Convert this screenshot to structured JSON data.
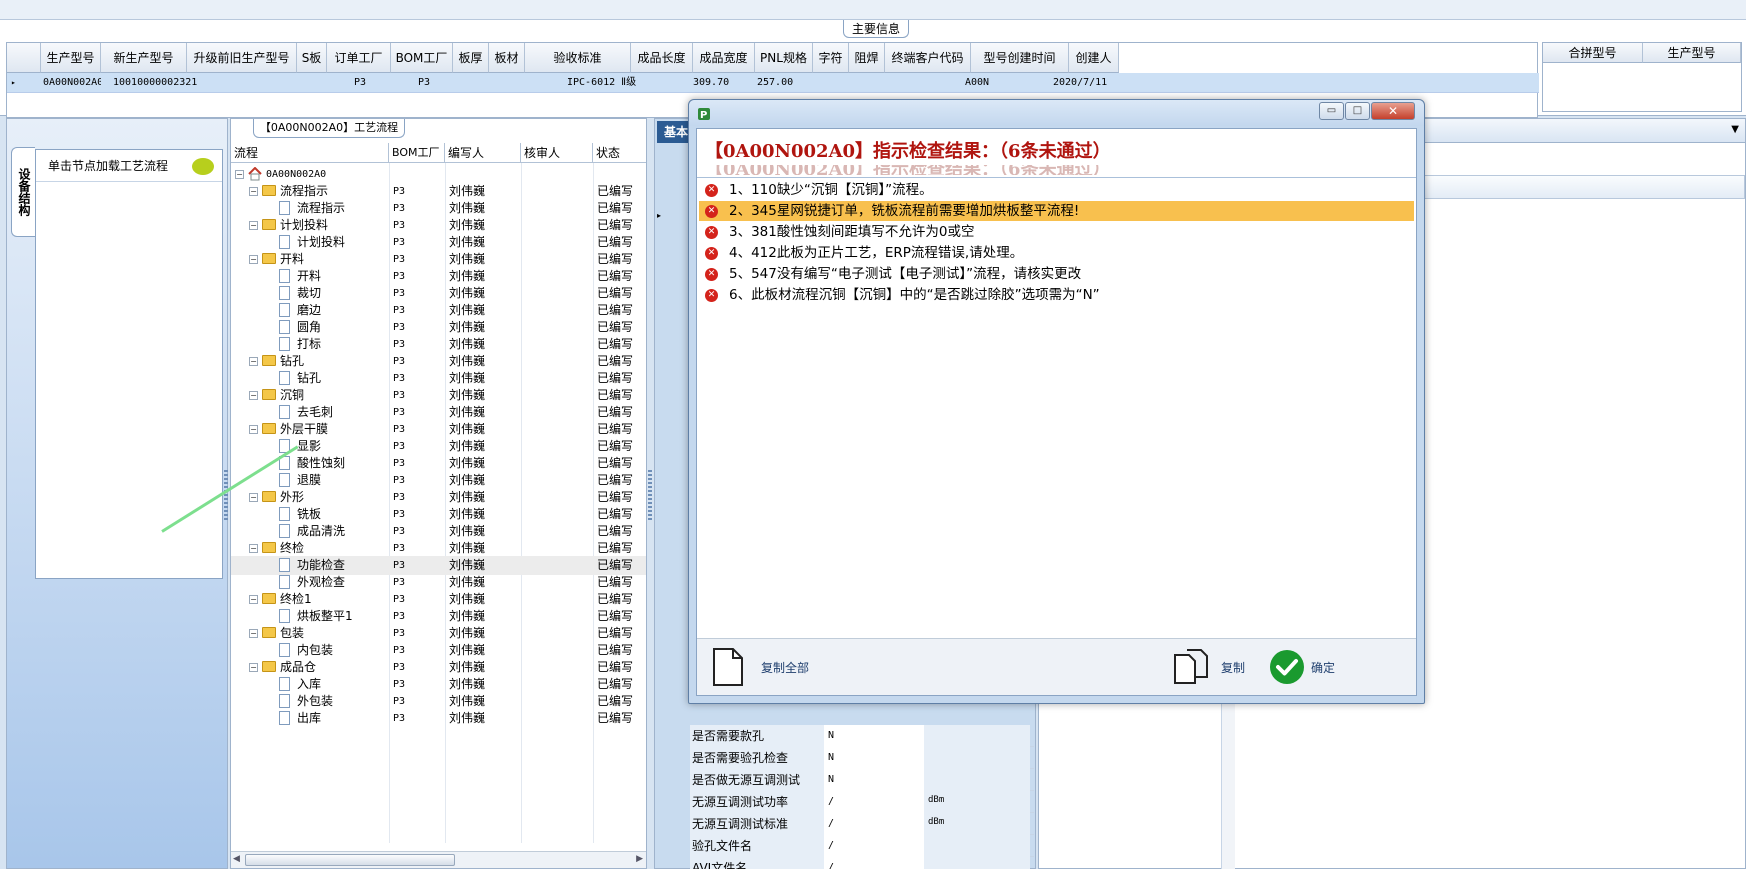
{
  "main_info": {
    "tab_label": "主要信息",
    "columns": [
      "生产型号",
      "新生产型号",
      "升级前旧生产型号",
      "S板",
      "订单工厂",
      "BOM工厂",
      "板厚",
      "板材",
      "验收标准",
      "成品长度",
      "成品宽度",
      "PNL规格",
      "字符",
      "阻焊",
      "终端客户代码",
      "型号创建时间",
      "创建人"
    ],
    "row": [
      "0A00N002A0",
      "10010000002321",
      "",
      "",
      "P3",
      "P3",
      "",
      "",
      "IPC-6012 Ⅱ级",
      "309.70",
      "257.00",
      "",
      "",
      "",
      "A00N",
      "2020/7/11",
      ""
    ],
    "merge_columns": [
      "合拼型号",
      "生产型号"
    ]
  },
  "left_panel": {
    "vertical_tab": "设备结构",
    "hint": "单击节点加载工艺流程"
  },
  "process_tree": {
    "tab_label": "【0A00N002A0】工艺流程",
    "headers": [
      "流程",
      "BOM工厂",
      "编写人",
      "核审人",
      "状态"
    ],
    "rows": [
      {
        "label": "0A00N002A0",
        "level": 0,
        "kind": "root",
        "bom": "",
        "writer": "",
        "checker": "",
        "status": ""
      },
      {
        "label": "流程指示",
        "level": 1,
        "kind": "folder",
        "bom": "P3",
        "writer": "刘伟巍",
        "checker": "",
        "status": "已编写"
      },
      {
        "label": "流程指示",
        "level": 2,
        "kind": "page",
        "bom": "P3",
        "writer": "刘伟巍",
        "checker": "",
        "status": "已编写"
      },
      {
        "label": "计划投料",
        "level": 1,
        "kind": "folder",
        "bom": "P3",
        "writer": "刘伟巍",
        "checker": "",
        "status": "已编写"
      },
      {
        "label": "计划投料",
        "level": 2,
        "kind": "page",
        "bom": "P3",
        "writer": "刘伟巍",
        "checker": "",
        "status": "已编写"
      },
      {
        "label": "开料",
        "level": 1,
        "kind": "folder",
        "bom": "P3",
        "writer": "刘伟巍",
        "checker": "",
        "status": "已编写"
      },
      {
        "label": "开料",
        "level": 2,
        "kind": "page",
        "bom": "P3",
        "writer": "刘伟巍",
        "checker": "",
        "status": "已编写"
      },
      {
        "label": "裁切",
        "level": 2,
        "kind": "page",
        "bom": "P3",
        "writer": "刘伟巍",
        "checker": "",
        "status": "已编写"
      },
      {
        "label": "磨边",
        "level": 2,
        "kind": "page",
        "bom": "P3",
        "writer": "刘伟巍",
        "checker": "",
        "status": "已编写"
      },
      {
        "label": "圆角",
        "level": 2,
        "kind": "page",
        "bom": "P3",
        "writer": "刘伟巍",
        "checker": "",
        "status": "已编写"
      },
      {
        "label": "打标",
        "level": 2,
        "kind": "page",
        "bom": "P3",
        "writer": "刘伟巍",
        "checker": "",
        "status": "已编写"
      },
      {
        "label": "钻孔",
        "level": 1,
        "kind": "folder",
        "bom": "P3",
        "writer": "刘伟巍",
        "checker": "",
        "status": "已编写"
      },
      {
        "label": "钻孔",
        "level": 2,
        "kind": "page",
        "bom": "P3",
        "writer": "刘伟巍",
        "checker": "",
        "status": "已编写"
      },
      {
        "label": "沉铜",
        "level": 1,
        "kind": "folder",
        "bom": "P3",
        "writer": "刘伟巍",
        "checker": "",
        "status": "已编写"
      },
      {
        "label": "去毛刺",
        "level": 2,
        "kind": "page",
        "bom": "P3",
        "writer": "刘伟巍",
        "checker": "",
        "status": "已编写"
      },
      {
        "label": "外层干膜",
        "level": 1,
        "kind": "folder",
        "bom": "P3",
        "writer": "刘伟巍",
        "checker": "",
        "status": "已编写"
      },
      {
        "label": "显影",
        "level": 2,
        "kind": "page",
        "bom": "P3",
        "writer": "刘伟巍",
        "checker": "",
        "status": "已编写"
      },
      {
        "label": "酸性蚀刻",
        "level": 2,
        "kind": "page",
        "bom": "P3",
        "writer": "刘伟巍",
        "checker": "",
        "status": "已编写"
      },
      {
        "label": "退膜",
        "level": 2,
        "kind": "page",
        "bom": "P3",
        "writer": "刘伟巍",
        "checker": "",
        "status": "已编写"
      },
      {
        "label": "外形",
        "level": 1,
        "kind": "folder",
        "bom": "P3",
        "writer": "刘伟巍",
        "checker": "",
        "status": "已编写"
      },
      {
        "label": "铣板",
        "level": 2,
        "kind": "page",
        "bom": "P3",
        "writer": "刘伟巍",
        "checker": "",
        "status": "已编写"
      },
      {
        "label": "成品清洗",
        "level": 2,
        "kind": "page",
        "bom": "P3",
        "writer": "刘伟巍",
        "checker": "",
        "status": "已编写"
      },
      {
        "label": "终检",
        "level": 1,
        "kind": "folder",
        "bom": "P3",
        "writer": "刘伟巍",
        "checker": "",
        "status": "已编写"
      },
      {
        "label": "功能检查",
        "level": 2,
        "kind": "page",
        "bom": "P3",
        "writer": "刘伟巍",
        "checker": "",
        "status": "已编写",
        "selected": true
      },
      {
        "label": "外观检查",
        "level": 2,
        "kind": "page",
        "bom": "P3",
        "writer": "刘伟巍",
        "checker": "",
        "status": "已编写"
      },
      {
        "label": "终检1",
        "level": 1,
        "kind": "folder",
        "bom": "P3",
        "writer": "刘伟巍",
        "checker": "",
        "status": "已编写"
      },
      {
        "label": "烘板整平1",
        "level": 2,
        "kind": "page",
        "bom": "P3",
        "writer": "刘伟巍",
        "checker": "",
        "status": "已编写"
      },
      {
        "label": "包装",
        "level": 1,
        "kind": "folder",
        "bom": "P3",
        "writer": "刘伟巍",
        "checker": "",
        "status": "已编写"
      },
      {
        "label": "内包装",
        "level": 2,
        "kind": "page",
        "bom": "P3",
        "writer": "刘伟巍",
        "checker": "",
        "status": "已编写"
      },
      {
        "label": "成品仓",
        "level": 1,
        "kind": "folder",
        "bom": "P3",
        "writer": "刘伟巍",
        "checker": "",
        "status": "已编写"
      },
      {
        "label": "入库",
        "level": 2,
        "kind": "page",
        "bom": "P3",
        "writer": "刘伟巍",
        "checker": "",
        "status": "已编写"
      },
      {
        "label": "外包装",
        "level": 2,
        "kind": "page",
        "bom": "P3",
        "writer": "刘伟巍",
        "checker": "",
        "status": "已编写"
      },
      {
        "label": "出库",
        "level": 2,
        "kind": "page",
        "bom": "P3",
        "writer": "刘伟巍",
        "checker": "",
        "status": "已编写"
      }
    ]
  },
  "properties": {
    "tab_label": "基本",
    "rows": [
      {
        "key": "是否需要款孔",
        "value": "N",
        "unit": ""
      },
      {
        "key": "是否需要验孔检查",
        "value": "N",
        "unit": ""
      },
      {
        "key": "是否做无源互调测试",
        "value": "N",
        "unit": ""
      },
      {
        "key": "无源互调测试功率",
        "value": "/",
        "unit": "dBm"
      },
      {
        "key": "无源互调测试标准",
        "value": "/",
        "unit": "dBm"
      },
      {
        "key": "验孔文件名",
        "value": "/",
        "unit": ""
      },
      {
        "key": "AVI文件名",
        "value": "/",
        "unit": ""
      }
    ]
  },
  "dialog": {
    "title": "【0A00N002A0】指示检查结果：（6条未通过）",
    "ghost_title": "【0A00N002A0】指示检查结果：（6条未通过）",
    "errors": [
      "1、110缺少“沉铜【沉铜】”流程。",
      "2、345星网锐捷订单，铣板流程前需要增加烘板整平流程!",
      "3、381酸性蚀刻间距填写不允许为0或空",
      "4、412此板为正片工艺，ERP流程错误,请处理。",
      "5、547没有编写“电子测试【电子测试】”流程，请核实更改",
      "6、此板材流程沉铜【沉铜】中的“是否跳过除胶”选项需为“N”"
    ],
    "highlighted_index": 1,
    "buttons": {
      "copy_all": "复制全部",
      "copy": "复制",
      "ok": "确定"
    },
    "window_buttons": {
      "minimize": "▭",
      "maximize": "□",
      "close": "✕"
    }
  },
  "colors": {
    "title_red": "#b0150f",
    "highlight": "#f8c04e",
    "error_icon": "#d4231b",
    "ok_green": "#1a9a2f"
  }
}
